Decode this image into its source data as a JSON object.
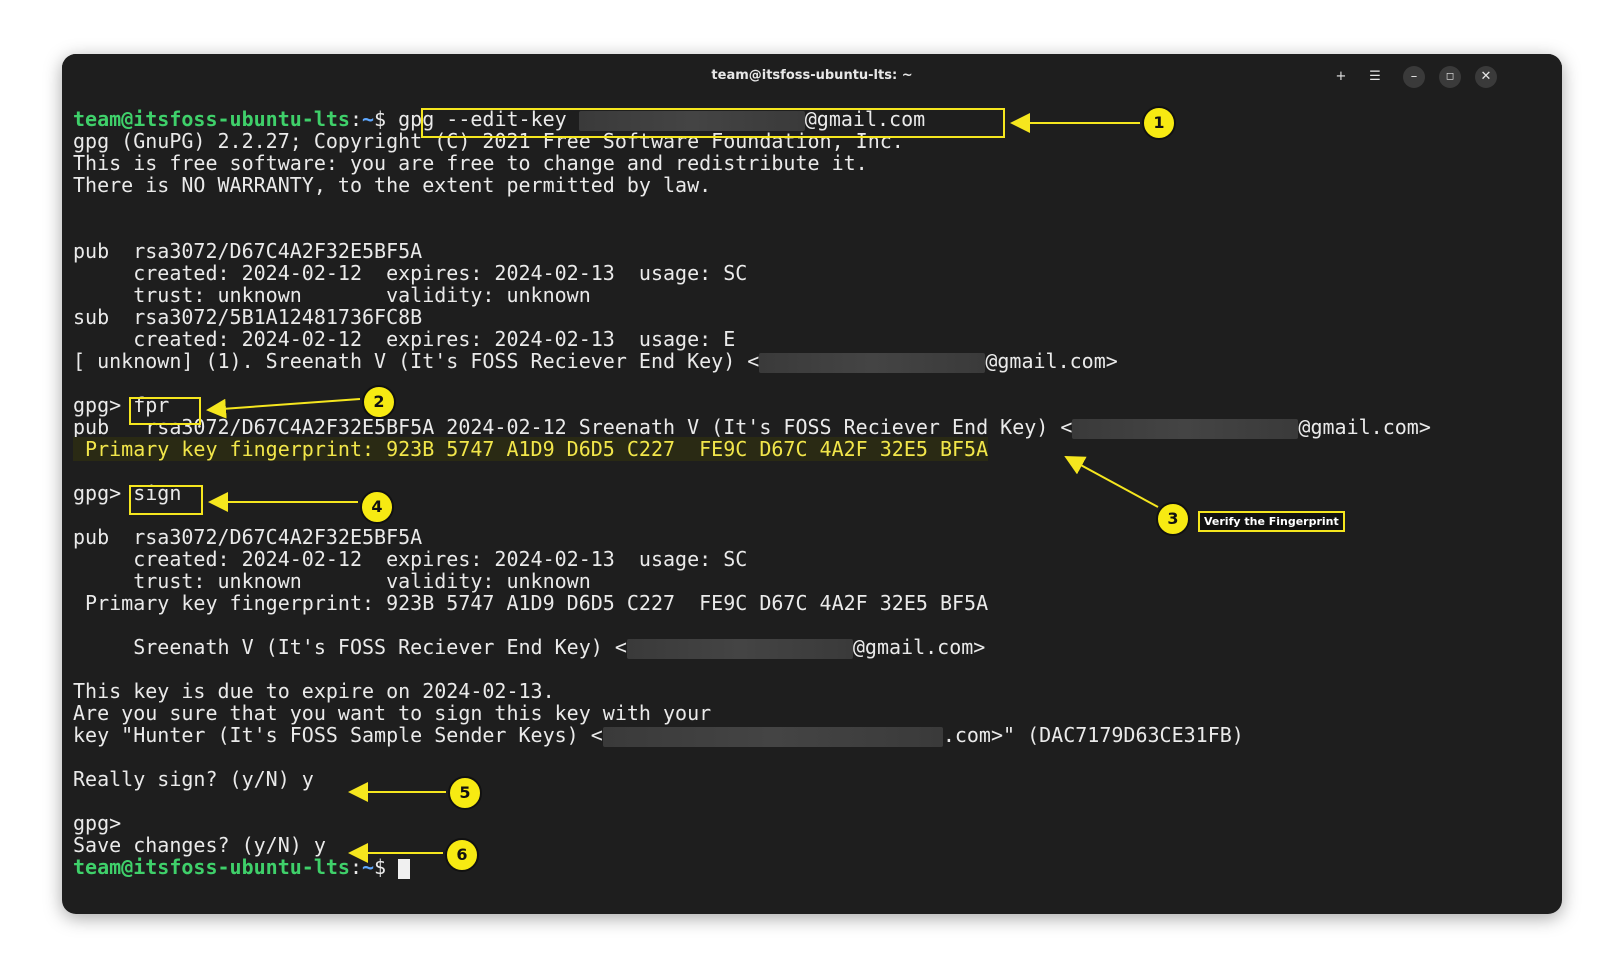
{
  "window": {
    "title": "team@itsfoss-ubuntu-lts: ~",
    "new_tab_icon": "plus-icon",
    "menu_icon": "hamburger-icon",
    "minimize_icon": "minimize-icon",
    "maximize_icon": "maximize-icon",
    "close_icon": "close-icon"
  },
  "prompt": {
    "user": "team@itsfoss-ubuntu-lts",
    "colon": ":",
    "path": "~",
    "symbol": "$ "
  },
  "terminal": {
    "cmd_prefix": "gpg --edit-key ",
    "cmd_suffix": "@gmail.com",
    "banner1": "gpg (GnuPG) 2.2.27; Copyright (C) 2021 Free Software Foundation, Inc.",
    "banner2": "This is free software: you are free to change and redistribute it.",
    "banner3": "There is NO WARRANTY, to the extent permitted by law.",
    "pub1": "pub  rsa3072/D67C4A2F32E5BF5A",
    "created1": "     created: 2024-02-12  expires: 2024-02-13  usage: SC",
    "trust1": "     trust: unknown       validity: unknown",
    "sub1": "sub  rsa3072/5B1A12481736FC8B",
    "created_sub": "     created: 2024-02-12  expires: 2024-02-13  usage: E",
    "uid_prefix": "[ unknown] (1). Sreenath V (It's FOSS Reciever End Key) <",
    "uid_suffix": "@gmail.com>",
    "gpg_prompt": "gpg> ",
    "fpr_cmd": "fpr",
    "fpr_pub_prefix": "pub   rsa3072/D67C4A2F32E5BF5A 2024-02-12 Sreenath V (It's FOSS Reciever End Key) <",
    "fpr_pub_suffix": "@gmail.com>",
    "fingerprint_hl": " Primary key fingerprint: 923B 5747 A1D9 D6D5 C227  FE9C D67C 4A2F 32E5 BF5A",
    "sign_cmd": "sign",
    "pub2": "pub  rsa3072/D67C4A2F32E5BF5A",
    "created2": "     created: 2024-02-12  expires: 2024-02-13  usage: SC",
    "trust2": "     trust: unknown       validity: unknown",
    "fingerprint2": " Primary key fingerprint: 923B 5747 A1D9 D6D5 C227  FE9C D67C 4A2F 32E5 BF5A",
    "uid2_prefix": "     Sreenath V (It's FOSS Reciever End Key) <",
    "uid2_suffix": "@gmail.com>",
    "expire_msg": "This key is due to expire on 2024-02-13.",
    "sure_msg": "Are you sure that you want to sign this key with your",
    "signer_prefix": "key \"Hunter (It's FOSS Sample Sender Keys) <",
    "signer_suffix": ".com>\" (DAC7179D63CE31FB)",
    "really_sign": "Really sign? (y/N) y",
    "gpg_prompt_bare": "gpg>",
    "save_changes": "Save changes? (y/N) y"
  },
  "annotations": {
    "m1": "1",
    "m2": "2",
    "m3": "3",
    "m4": "4",
    "m5": "5",
    "m6": "6",
    "verify_note": "Verify the Fingerprint"
  },
  "colors": {
    "annotation": "#f5e61e",
    "prompt_user": "#3fd06a",
    "prompt_path": "#5fa8ff",
    "terminal_bg": "#1e1e1e"
  }
}
